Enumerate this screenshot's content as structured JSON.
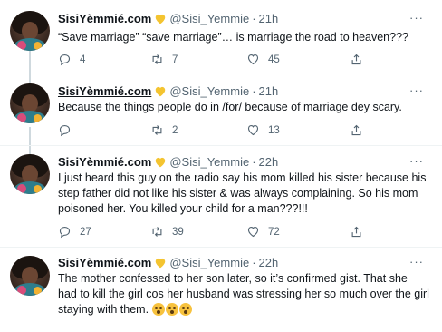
{
  "tweets": [
    {
      "name": "SisiYèmmié.com",
      "handle": "@Sisi_Yemmie",
      "time": "21h",
      "text": "“Save marriage” “save marriage”… is marriage the road to heaven???",
      "replies": "4",
      "retweets": "7",
      "likes": "45"
    },
    {
      "name": "SisiYèmmié.com",
      "handle": "@Sisi_Yemmie",
      "time": "21h",
      "text": "Because the things people do in /for/ because of marriage dey scary.",
      "replies": "",
      "retweets": "2",
      "likes": "13"
    },
    {
      "name": "SisiYèmmié.com",
      "handle": "@Sisi_Yemmie",
      "time": "22h",
      "text": "I just heard this guy on the radio say his mom killed his sister because his step father did not like his sister & was always complaining. So his mom poisoned her. You killed your child for a man???!!!",
      "replies": "27",
      "retweets": "39",
      "likes": "72"
    },
    {
      "name": "SisiYèmmié.com",
      "handle": "@Sisi_Yemmie",
      "time": "22h",
      "text": "The mother confessed to her son later, so it’s confirmed gist. That she had to kill the girl cos her husband was stressing her so much over the girl staying with them.",
      "emojis": [
        "flushed-face",
        "astonished-face",
        "hushed-face"
      ]
    }
  ],
  "ui": {
    "separator": "·",
    "more": "···",
    "heart_color": "#f4c430"
  }
}
